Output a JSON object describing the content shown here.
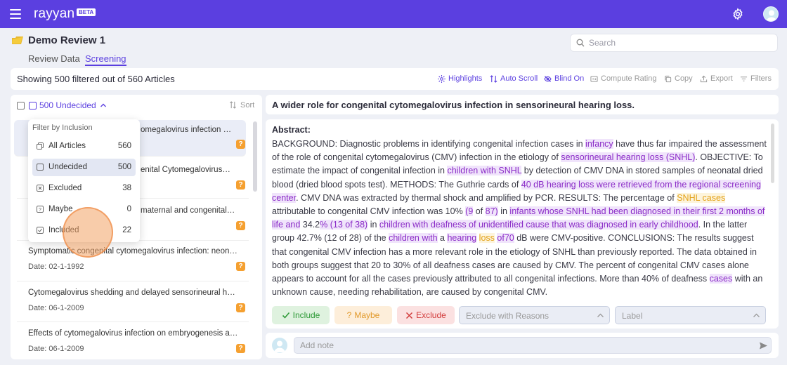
{
  "app": {
    "brand": "rayyan",
    "badge": "BETA"
  },
  "colors": {
    "accent": "#5b3fe0",
    "highlight_purple": "#8a2bc7",
    "highlight_yellow": "#e3a21a",
    "include": "#2f9a38",
    "maybe": "#e29a2c",
    "exclude": "#d23b3b"
  },
  "header": {
    "project_title": "Demo Review 1",
    "tabs": [
      {
        "label": "Review Data"
      },
      {
        "label": "Screening"
      }
    ],
    "search_placeholder": "Search"
  },
  "toolbar": {
    "showing": "Showing 500 filtered out of 560 Articles",
    "tools": [
      {
        "label": "Highlights",
        "icon": "highlights-icon"
      },
      {
        "label": "Auto Scroll",
        "icon": "auto-scroll-icon"
      },
      {
        "label": "Blind On",
        "icon": "blind-icon"
      },
      {
        "label": "Compute Rating",
        "icon": "compute-rating-icon"
      },
      {
        "label": "Copy",
        "icon": "copy-icon"
      },
      {
        "label": "Export",
        "icon": "export-icon"
      },
      {
        "label": "Filters",
        "icon": "filter-icon"
      }
    ]
  },
  "list": {
    "count_label": "500 Undecided",
    "sort_label": "Sort",
    "articles": [
      {
        "title": "Cytomegalovirus infection in sensorineural hearing loss",
        "title_visible": "omegalovirus infection in sen...",
        "date": ""
      },
      {
        "title_visible": "enital Cytomegalovirus Infe...",
        "date": ""
      },
      {
        "title_visible": "maternal and congenital cy...",
        "date": ""
      },
      {
        "title_visible": "Symptomatic congenital cytomegalovirus infection: neonat...",
        "date": "Date: 02-1-1992"
      },
      {
        "title_visible": "Cytomegalovirus shedding and delayed sensorineural hear...",
        "date": "Date: 06-1-2009"
      },
      {
        "title_visible": "Effects of cytomegalovirus infection on embryogenesis and...",
        "date": "Date: 06-1-2009"
      }
    ],
    "badge_glyph": "?"
  },
  "filter_dropdown": {
    "heading": "Filter by Inclusion",
    "items": [
      {
        "label": "All Articles",
        "count": "560"
      },
      {
        "label": "Undecided",
        "count": "500"
      },
      {
        "label": "Excluded",
        "count": "38"
      },
      {
        "label": "Maybe",
        "count": "0"
      },
      {
        "label": "Included",
        "count": "22"
      }
    ]
  },
  "article_detail": {
    "title": "A wider role for congenital cytomegalovirus infection in sensorineural hearing loss.",
    "abstract_label": "Abstract:",
    "abstract_segments": [
      {
        "t": "BACKGROUND: Diagnostic problems in identifying congenital infection cases in "
      },
      {
        "t": "infancy",
        "h": "p"
      },
      {
        "t": " have thus far impaired the assessment of the role of congenital cytomegalovirus (CMV) infection in the etiology of "
      },
      {
        "t": "sensorineural hearing loss (SNHL)",
        "h": "p"
      },
      {
        "t": ". OBJECTIVE: To estimate the impact of congenital infection in "
      },
      {
        "t": "children with SNHL",
        "h": "p"
      },
      {
        "t": " by detection of CMV DNA in stored samples of neonatal dried blood (dried blood spots test). METHODS: The Guthrie cards of "
      },
      {
        "t": "40 dB hearing loss were retrieved from the regional screening center",
        "h": "p"
      },
      {
        "t": ". CMV DNA was extracted by thermal shock and amplified by PCR. RESULTS: The percentage of "
      },
      {
        "t": "SNHL cases",
        "h": "y"
      },
      {
        "t": " attributable to congenital CMV infection was 10% "
      },
      {
        "t": "(9",
        "h": "p"
      },
      {
        "t": " of "
      },
      {
        "t": "87)",
        "h": "p"
      },
      {
        "t": " in "
      },
      {
        "t": "infants whose SNHL had been diagnosed in their first 2 months of life and",
        "h": "p"
      },
      {
        "t": " 34.2"
      },
      {
        "t": "% (13 of 38)",
        "h": "p"
      },
      {
        "t": " in "
      },
      {
        "t": "children with deafness of unidentified cause that was diagnosed in early childhood",
        "h": "p"
      },
      {
        "t": ". In the latter group 42.7% (12 of 28) of the "
      },
      {
        "t": "children with",
        "h": "p"
      },
      {
        "t": " a "
      },
      {
        "t": "hearing",
        "h": "p"
      },
      {
        "t": " "
      },
      {
        "t": "loss",
        "h": "y"
      },
      {
        "t": " "
      },
      {
        "t": "of70",
        "h": "p"
      },
      {
        "t": " dB were CMV-positive. CONCLUSIONS: The results suggest that congenital CMV infection has a more relevant role in the etiology of SNHL than previously reported. The data obtained in both groups suggest that 20 to 30% of all deafness cases are caused by CMV. The percent of congenital CMV cases alone appears to account for all the cases previously attributed to all congenital infections. More than 40% of deafness "
      },
      {
        "t": "cases",
        "h": "p"
      },
      {
        "t": " with an unknown cause, needing rehabilitation, are caused by congenital CMV."
      }
    ],
    "actions": {
      "include": "Include",
      "maybe": "Maybe",
      "exclude": "Exclude"
    },
    "reasons_placeholder": "Exclude with Reasons",
    "label_placeholder": "Label",
    "note_placeholder": "Add note"
  }
}
